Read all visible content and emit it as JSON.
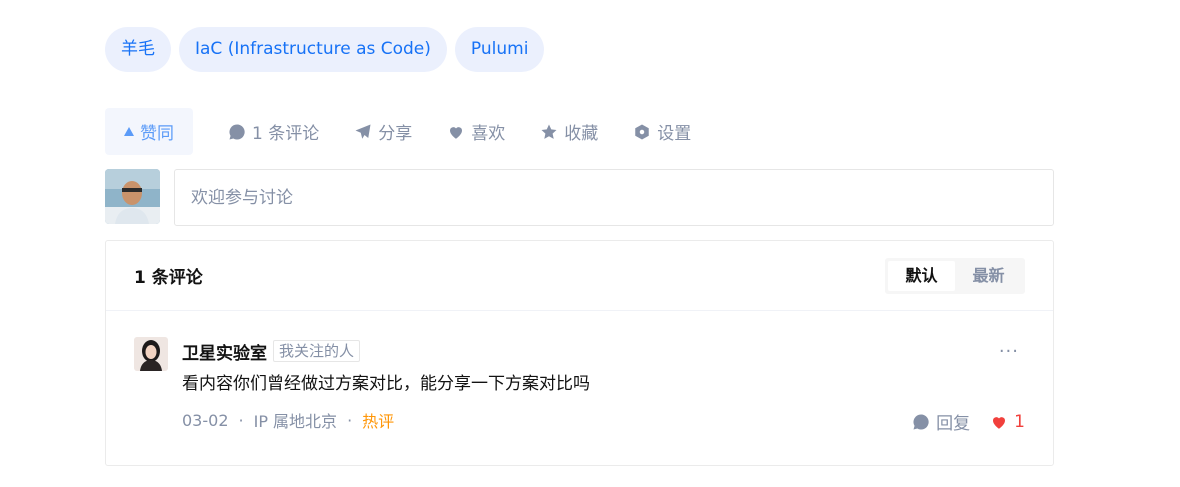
{
  "tags": [
    "羊毛",
    "IaC (Infrastructure as Code)",
    "Pulumi"
  ],
  "actions": {
    "vote": "赞同",
    "comment": "1 条评论",
    "share": "分享",
    "like": "喜欢",
    "collect": "收藏",
    "settings": "设置"
  },
  "composer": {
    "placeholder": "欢迎参与讨论"
  },
  "comments": {
    "title": "1 条评论",
    "sort": {
      "default": "默认",
      "latest": "最新"
    },
    "item": {
      "author": "卫星实验室",
      "badge": "我关注的人",
      "text": "看内容你们曾经做过方案对比，能分享一下方案对比吗",
      "date": "03-02",
      "location": "IP 属地北京",
      "hot": "热评",
      "reply": "回复",
      "likes": "1",
      "more": "···"
    }
  },
  "colors": {
    "accent": "#1772f6",
    "muted": "#8590a6",
    "hot": "#ff9607",
    "heart": "#f1403c"
  }
}
